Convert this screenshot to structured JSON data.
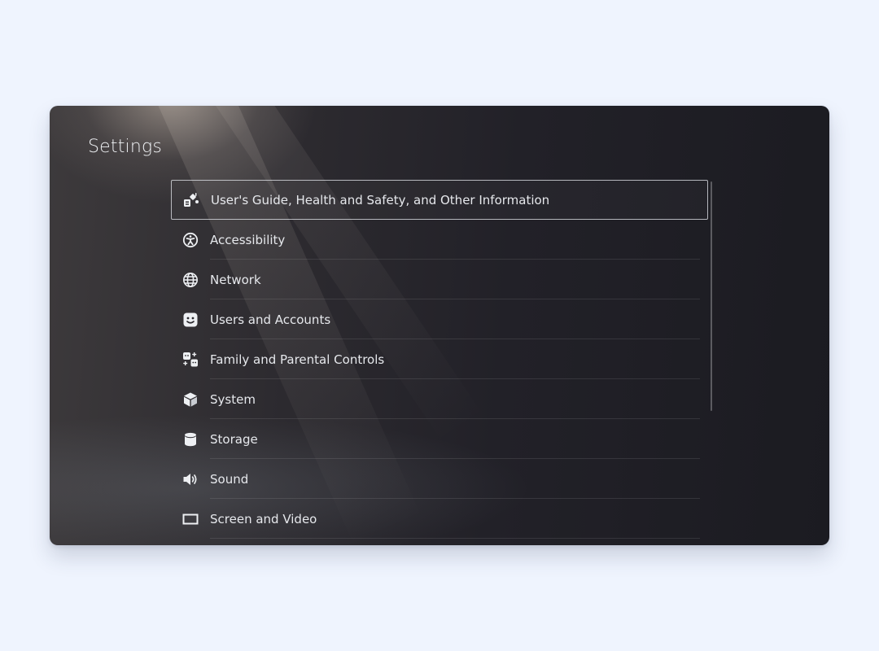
{
  "screen": {
    "title": "Settings"
  },
  "menu": {
    "items": [
      {
        "label": "User's Guide, Health and Safety, and Other Information",
        "icon": "guide-icon",
        "selected": true
      },
      {
        "label": "Accessibility",
        "icon": "accessibility-icon",
        "selected": false
      },
      {
        "label": "Network",
        "icon": "globe-icon",
        "selected": false
      },
      {
        "label": "Users and Accounts",
        "icon": "face-icon",
        "selected": false
      },
      {
        "label": "Family and Parental Controls",
        "icon": "family-icon",
        "selected": false
      },
      {
        "label": "System",
        "icon": "cube-icon",
        "selected": false
      },
      {
        "label": "Storage",
        "icon": "database-icon",
        "selected": false
      },
      {
        "label": "Sound",
        "icon": "speaker-icon",
        "selected": false
      },
      {
        "label": "Screen and Video",
        "icon": "screen-icon",
        "selected": false
      }
    ]
  },
  "colors": {
    "page_background": "#eff4fe",
    "text": "#e6e8ec",
    "selection_border": "#e6e8ee"
  }
}
